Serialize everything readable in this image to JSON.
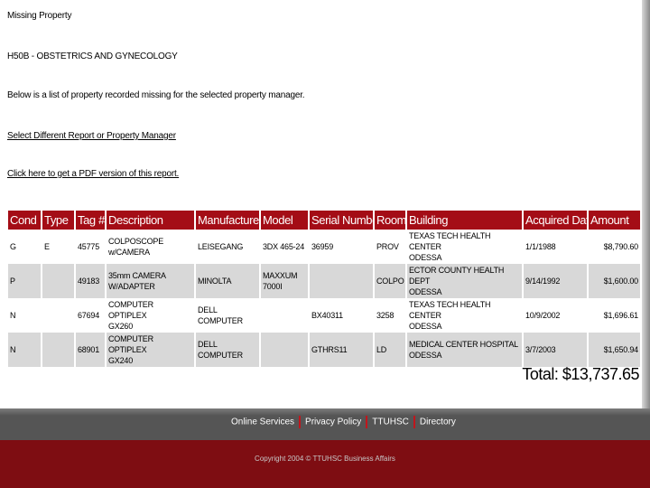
{
  "page": {
    "title": "Missing Property",
    "subtitle": "H50B - OBSTETRICS AND GYNECOLOGY",
    "description": "Below is a list of property recorded missing for the selected property manager.",
    "link_select": "Select Different Report or Property Manager",
    "link_pdf": "Click here to get a PDF version of this report."
  },
  "table": {
    "headers": [
      "Cond",
      "Type",
      "Tag #",
      "Description",
      "Manufacturer",
      "Model",
      "Serial Number",
      "Room",
      "Building",
      "Acquired Date",
      "Amount"
    ],
    "rows": [
      {
        "cond": "G",
        "type": "E",
        "tag": "45775",
        "description": "COLPOSCOPE w/CAMERA",
        "manufacturer": "LEISEGANG",
        "model": "3DX 465-24",
        "serial": "36959",
        "room": "PROV",
        "building_line1": "TEXAS TECH HEALTH CENTER",
        "building_line2": "ODESSA",
        "acquired": "1/1/1988",
        "amount": "$8,790.60"
      },
      {
        "cond": "P",
        "type": "",
        "tag": "49183",
        "description_line1": "35mm CAMERA",
        "description_line2": "W/ADAPTER",
        "manufacturer": "MINOLTA",
        "model_line1": "MAXXUM",
        "model_line2": "7000I",
        "serial": "",
        "room": "COLPO",
        "building_line1": "ECTOR COUNTY HEALTH DEPT",
        "building_line2": "ODESSA",
        "acquired": "9/14/1992",
        "amount": "$1,600.00"
      },
      {
        "cond": "N",
        "type": "",
        "tag": "67694",
        "description_line1": "COMPUTER OPTIPLEX",
        "description_line2": "GX260",
        "manufacturer": "DELL COMPUTER",
        "model": "",
        "serial": "BX40311",
        "room": "3258",
        "building_line1": "TEXAS TECH HEALTH CENTER",
        "building_line2": "ODESSA",
        "acquired": "10/9/2002",
        "amount": "$1,696.61"
      },
      {
        "cond": "N",
        "type": "",
        "tag": "68901",
        "description_line1": "COMPUTER OPTIPLEX",
        "description_line2": "GX240",
        "manufacturer": "DELL COMPUTER",
        "model": "",
        "serial": "GTHRS11",
        "room": "LD",
        "building_line1": "MEDICAL CENTER HOSPITAL",
        "building_line2": "ODESSA",
        "acquired": "3/7/2003",
        "amount": "$1,650.94"
      }
    ]
  },
  "total": {
    "label": "Total:",
    "value": "$13,737.65"
  },
  "footer": {
    "nav": [
      "Online Services",
      "Privacy Policy",
      "TTUHSC",
      "Directory"
    ],
    "copyright": "Copyright 2004 © TTUHSC Business Affairs"
  },
  "colors": {
    "header_red": "#a40d16",
    "footer_gray": "#555555",
    "footer_red": "#7e0d12",
    "row_alt": "#d8d8d8"
  }
}
